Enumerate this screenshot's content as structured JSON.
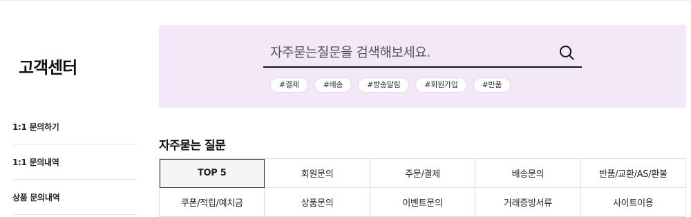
{
  "sidebar": {
    "title": "고객센터",
    "items": [
      {
        "label": "1:1 문의하기"
      },
      {
        "label": "1:1 문의내역"
      },
      {
        "label": "상품 문의내역"
      }
    ]
  },
  "search": {
    "placeholder": "자주묻는질문을 검색해보세요.",
    "tags": [
      "#결제",
      "#배송",
      "#방송알림",
      "#회원가입",
      "#반품"
    ]
  },
  "faq": {
    "title": "자주묻는 질문",
    "categories": [
      {
        "label": "TOP 5",
        "active": true
      },
      {
        "label": "회원문의"
      },
      {
        "label": "주문/결제"
      },
      {
        "label": "배송문의"
      },
      {
        "label": "반품/교환/AS/환불"
      },
      {
        "label": "쿠폰/적립/예치금"
      },
      {
        "label": "상품문의"
      },
      {
        "label": "이벤트문의"
      },
      {
        "label": "거래증빙서류"
      },
      {
        "label": "사이트이용"
      }
    ]
  },
  "colors": {
    "panel_bg": "#f3e8f8",
    "active_tab_bg": "#f4f5f4"
  }
}
